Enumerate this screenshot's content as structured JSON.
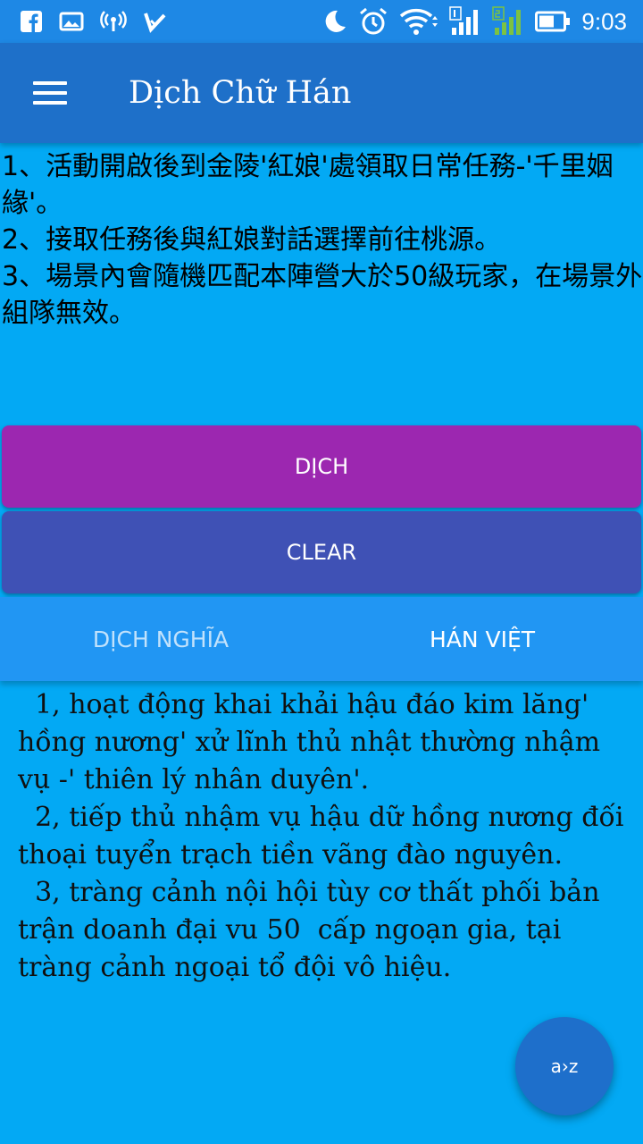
{
  "status_bar": {
    "time": "9:03",
    "left_icons": [
      "facebook-icon",
      "gallery-icon",
      "hotspot-icon",
      "notification-check-icon"
    ],
    "right_icons": [
      "moon-icon",
      "alarm-icon",
      "wifi-icon",
      "signal-1-icon",
      "signal-2-icon",
      "battery-icon"
    ]
  },
  "app_bar": {
    "title": "Dịch Chữ Hán",
    "menu_icon": "hamburger-menu-icon"
  },
  "input": {
    "text": "1、活動開啟後到金陵'紅娘'處領取日常任務-'千里姻緣'。\n2、接取任務後與紅娘對話選擇前往桃源。\n3、場景內會隨機匹配本陣營大於50級玩家，在場景外組隊無效。"
  },
  "buttons": {
    "translate": "DỊCH",
    "clear": "CLEAR"
  },
  "tabs": {
    "meaning": "DỊCH NGHĨA",
    "han_viet": "HÁN VIỆT",
    "active": "han_viet"
  },
  "output": {
    "text": "  1, hoạt động khai khải hậu đáo kim lăng' hồng nương' xử lĩnh thủ nhật thường nhậm vụ -' thiên lý nhân duyên'.\n  2, tiếp thủ nhậm vụ hậu dữ hồng nương đối thoại tuyển trạch tiền vãng đào nguyên.\n  3, tràng cảnh nội hội tùy cơ thất phối bản trận doanh đại vu 50  cấp ngoạn gia, tại tràng cảnh ngoại tổ đội vô hiệu."
  },
  "fab": {
    "label": "a›z",
    "icon": "translate-az-icon"
  },
  "colors": {
    "background": "#03A9F4",
    "status_bar": "#1E88E5",
    "app_bar": "#1E70C9",
    "translate_button": "#9C27B0",
    "clear_button": "#3F51B5",
    "tabs": "#2196F3",
    "fab": "#1E6FCB"
  }
}
